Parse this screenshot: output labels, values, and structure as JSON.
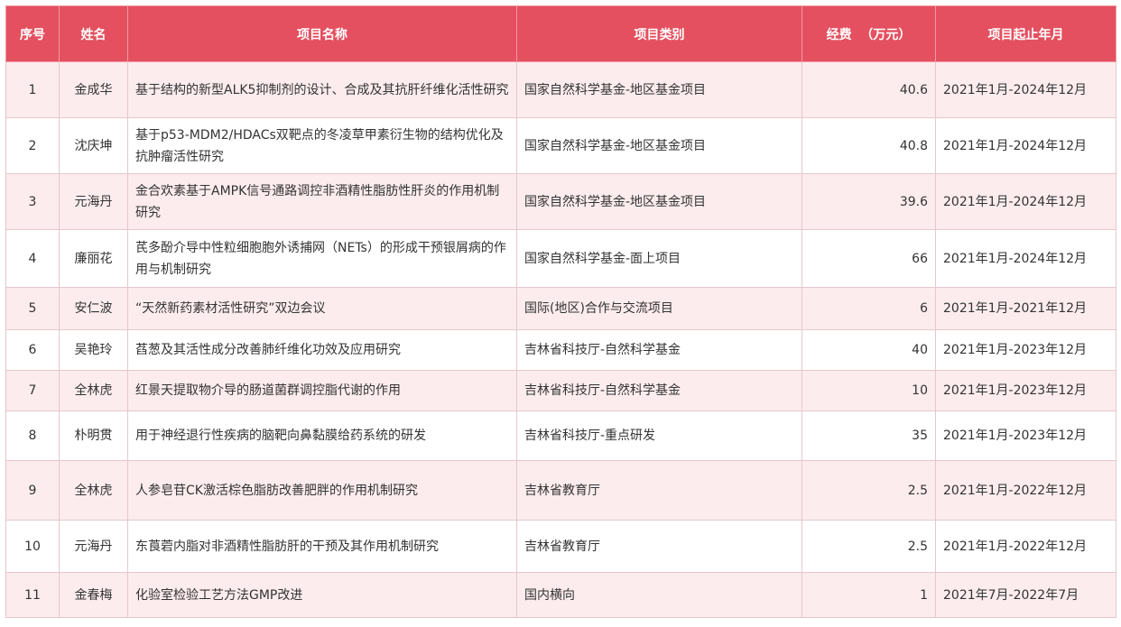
{
  "headers": {
    "index": "序号",
    "name": "姓名",
    "title": "项目名称",
    "category": "项目类别",
    "funding": "经费  （万元）",
    "period": "项目起止年月"
  },
  "rows": [
    {
      "index": "1",
      "name": "金成华",
      "title": "基于结构的新型ALK5抑制剂的设计、合成及其抗肝纤维化活性研究",
      "category": "国家自然科学基金-地区基金项目",
      "funding": "40.6",
      "period": "2021年1月-2024年12月"
    },
    {
      "index": "2",
      "name": "沈庆坤",
      "title": "基于p53-MDM2/HDACs双靶点的冬凌草甲素衍生物的结构优化及抗肿瘤活性研究",
      "category": "国家自然科学基金-地区基金项目",
      "funding": "40.8",
      "period": "2021年1月-2024年12月"
    },
    {
      "index": "3",
      "name": "元海丹",
      "title": "金合欢素基于AMPK信号通路调控非酒精性脂肪性肝炎的作用机制研究",
      "category": "国家自然科学基金-地区基金项目",
      "funding": "39.6",
      "period": "2021年1月-2024年12月"
    },
    {
      "index": "4",
      "name": "廉丽花",
      "title": "芪多酚介导中性粒细胞胞外诱捕网（NETs）的形成干预银屑病的作用与机制研究",
      "category": "国家自然科学基金-面上项目",
      "funding": "66",
      "period": "2021年1月-2024年12月"
    },
    {
      "index": "5",
      "name": "安仁波",
      "title": "“天然新药素材活性研究”双边会议",
      "category": "国际(地区)合作与交流项目",
      "funding": "6",
      "period": "2021年1月-2021年12月"
    },
    {
      "index": "6",
      "name": "吴艳玲",
      "title": "萏葱及其活性成分改善肺纤维化功效及应用研究",
      "category": "吉林省科技厅-自然科学基金",
      "funding": "40",
      "period": "2021年1月-2023年12月"
    },
    {
      "index": "7",
      "name": "全林虎",
      "title": "红景天提取物介导的肠道菌群调控脂代谢的作用",
      "category": "吉林省科技厅-自然科学基金",
      "funding": "10",
      "period": "2021年1月-2023年12月"
    },
    {
      "index": "8",
      "name": "朴明贯",
      "title": "用于神经退行性疾病的脑靶向鼻黏膜给药系统的研发",
      "category": "吉林省科技厅-重点研发",
      "funding": "35",
      "period": "2021年1月-2023年12月"
    },
    {
      "index": "9",
      "name": "全林虎",
      "title": "人参皂苷CK激活棕色脂肪改善肥胖的作用机制研究",
      "category": "吉林省教育厅",
      "funding": "2.5",
      "period": "2021年1月-2022年12月"
    },
    {
      "index": "10",
      "name": "元海丹",
      "title": "东莨菪内脂对非酒精性脂肪肝的干预及其作用机制研究",
      "category": "吉林省教育厅",
      "funding": "2.5",
      "period": "2021年1月-2022年12月"
    },
    {
      "index": "11",
      "name": "金春梅",
      "title": "化验室检验工艺方法GMP改进",
      "category": "国内横向",
      "funding": "1",
      "period": "2021年7月-2022年7月"
    }
  ]
}
